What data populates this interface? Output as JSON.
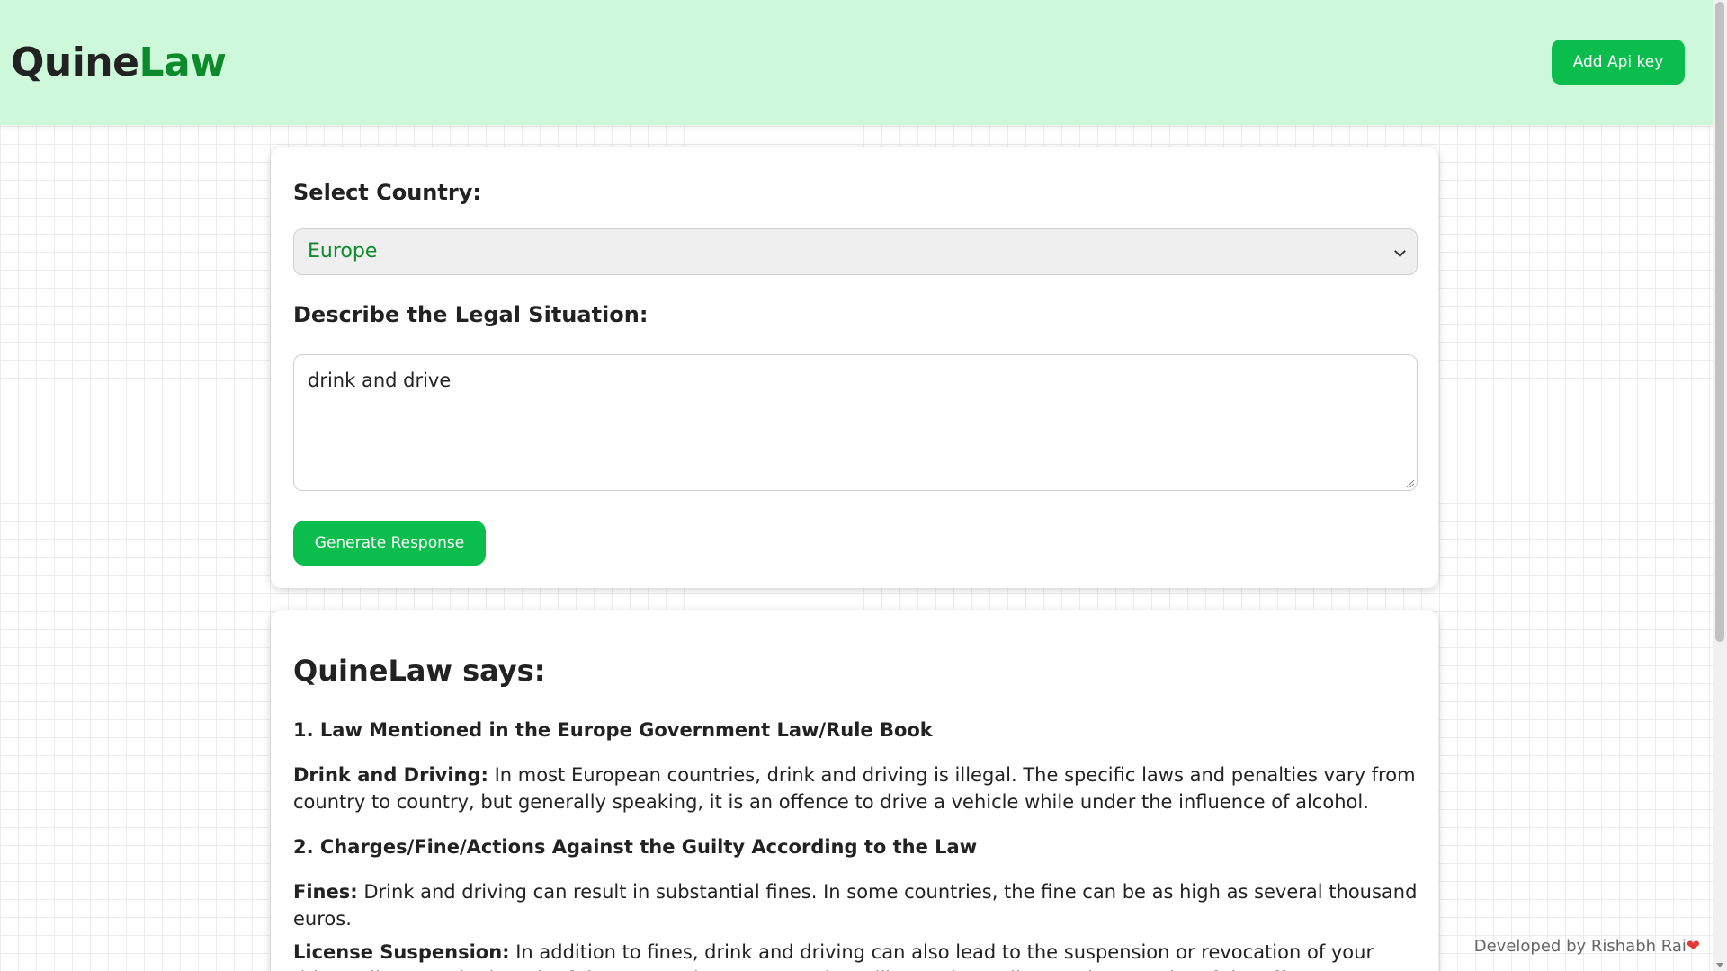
{
  "header": {
    "logo_part1": "Quine",
    "logo_part2": "Law",
    "api_button_label": "Add Api key",
    "background_color": "#cdf8da",
    "accent_color": "#0bbd4c"
  },
  "form": {
    "country_label": "Select Country:",
    "country_selected": "Europe",
    "situation_label": "Describe the Legal Situation:",
    "situation_value": "drink and drive",
    "generate_button_label": "Generate Response"
  },
  "response": {
    "title": "QuineLaw says:",
    "section1_heading": "1. Law Mentioned in the Europe Government Law/Rule Book",
    "item1_term": "Drink and Driving:",
    "item1_text": " In most European countries, drink and driving is illegal. The specific laws and penalties vary from country to country, but generally speaking, it is an offence to drive a vehicle while under the influence of alcohol.",
    "section2_heading": "2. Charges/Fine/Actions Against the Guilty According to the Law",
    "item2_term": "Fines:",
    "item2_text": " Drink and driving can result in substantial fines. In some countries, the fine can be as high as several thousand euros.",
    "item3_term": "License Suspension:",
    "item3_text": " In addition to fines, drink and driving can also lead to the suspension or revocation of your driver's license. The length of the suspension or revocation will vary depending on the severity of the offence."
  },
  "footer": {
    "credit": "Developed by Rishabh Rai",
    "heart_icon": "heart-icon"
  }
}
